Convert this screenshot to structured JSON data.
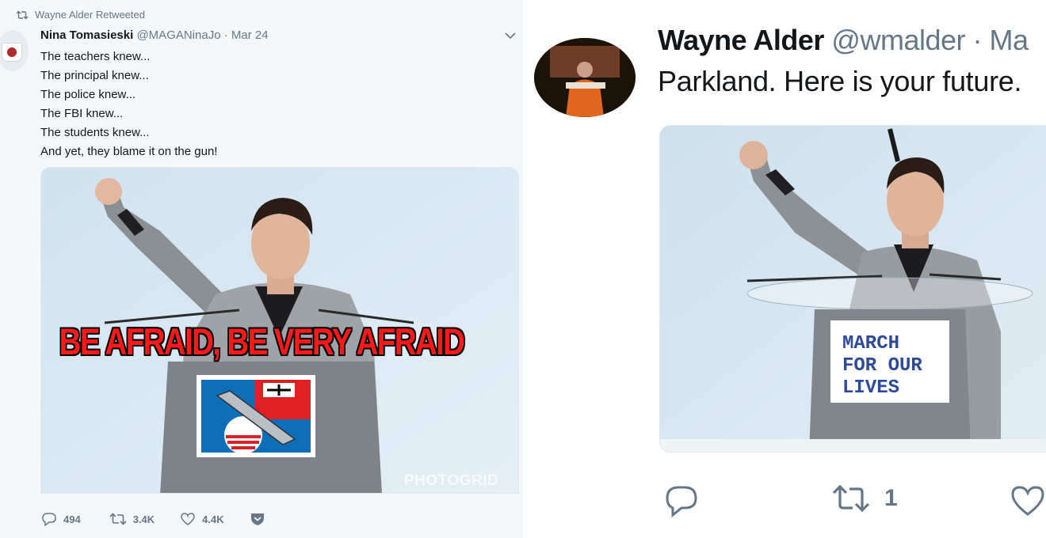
{
  "left_tweet": {
    "retweet_label": "Wayne Alder Retweeted",
    "author_name": "Nina Tomasieski",
    "author_handle": "@MAGANinaJo",
    "separator": "·",
    "date": "Mar 24",
    "lines": [
      "The teachers knew...",
      "The principal knew...",
      "The police knew...",
      "The FBI knew...",
      "The students knew...",
      "And yet, they blame it on the gun!"
    ],
    "media": {
      "caption": "BE AFRAID, BE VERY AFRAID",
      "watermark": "PHOTOGRID"
    },
    "actions": {
      "replies": "494",
      "retweets": "3.4K",
      "likes": "4.4K"
    },
    "icons": [
      "retweet-icon",
      "chevron-down-icon",
      "reply-icon",
      "heart-icon",
      "dm-icon"
    ]
  },
  "right_tweet": {
    "author_name": "Wayne Alder",
    "author_handle": "@wmalder",
    "separator": "·",
    "date_fragment": "Ma",
    "text": "Parkland. Here is your future.",
    "media": {
      "sign_lines": [
        "MARCH",
        "FOR OUR",
        "LIVES"
      ]
    },
    "actions": {
      "retweets": "1"
    }
  },
  "colors": {
    "background_left": "#f5f8fa",
    "text_primary": "#14171a",
    "text_secondary": "#657786",
    "caption_red": "#ff1a1a",
    "sign_blue": "#2d4a9b"
  }
}
